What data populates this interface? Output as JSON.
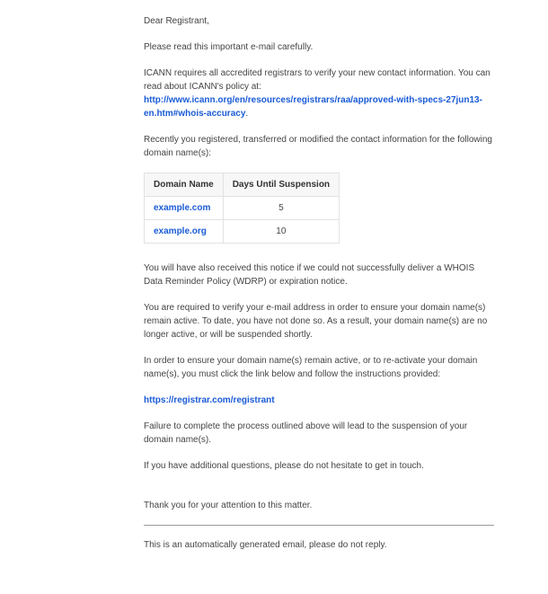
{
  "salutation": "Dear Registrant,",
  "intro": "Please read this important e-mail carefully.",
  "icann_line": "ICANN requires all accredited registrars to verify your new contact information. You can read about ICANN's policy at:",
  "icann_link": "http://www.icann.org/en/resources/registrars/raa/approved-with-specs-27jun13-en.htm#whois-accuracy",
  "period": ".",
  "recently": "Recently you registered, transferred or modified the contact information for the following domain name(s):",
  "table": {
    "col1": "Domain Name",
    "col2": "Days Until Suspension",
    "rows": [
      {
        "domain": "example.com",
        "days": "5"
      },
      {
        "domain": "example.org",
        "days": "10"
      }
    ]
  },
  "wdrp": "You will have also received this notice if we could not successfully deliver a WHOIS Data Reminder Policy (WDRP) or expiration notice.",
  "required": "You are required to verify your e-mail address in order to ensure your domain name(s) remain active. To date, you have not done so. As a result, your domain name(s) are no longer active, or will be suspended shortly.",
  "reactivate": "In order to ensure your domain name(s) remain active, or to re-activate your domain name(s), you must click the link below and follow the instructions provided:",
  "registrar_link": "https://registrar.com/registrant",
  "failure": "Failure to complete the process outlined above will lead to the suspension of your domain name(s).",
  "questions": "If you have additional questions, please do not hesitate to get in touch.",
  "thanks": "Thank you for your attention to this matter.",
  "auto": "This is an automatically generated email, please do not reply."
}
